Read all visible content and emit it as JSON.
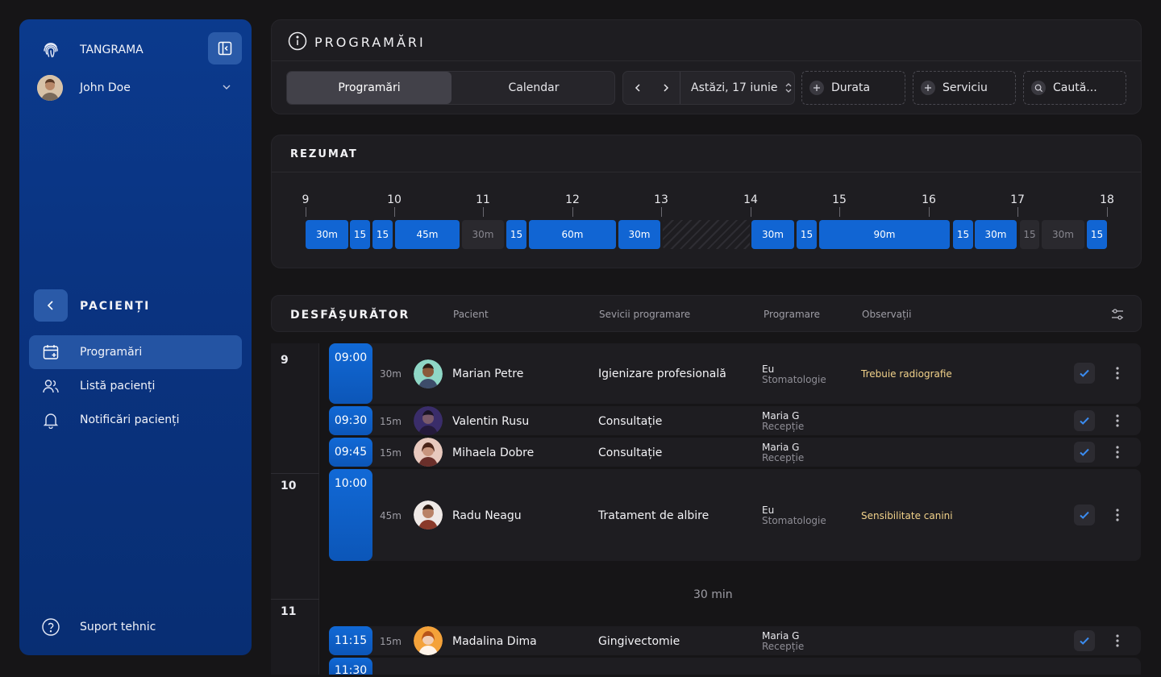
{
  "sidebar": {
    "brand": "TANGRAMA",
    "user": "John Doe",
    "section": "PACIENȚI",
    "items": [
      {
        "label": "Programări",
        "active": true
      },
      {
        "label": "Listă pacienți"
      },
      {
        "label": "Notificări pacienți"
      }
    ],
    "support": "Suport tehnic"
  },
  "header": {
    "title": "PROGRAMĂRI",
    "tabs": [
      "Programări",
      "Calendar"
    ],
    "date": "Astăzi, 17 iunie",
    "filters": [
      "Durata",
      "Serviciu"
    ],
    "search_placeholder": "Caută..."
  },
  "summary": {
    "title": "REZUMAT",
    "hours": [
      "9",
      "10",
      "11",
      "12",
      "13",
      "14",
      "15",
      "16",
      "17",
      "18"
    ],
    "blocks": [
      "30m",
      "15",
      "15",
      "45m",
      "30m",
      "15",
      "60m",
      "30m",
      "30m",
      "15",
      "90m",
      "15",
      "30m",
      "15",
      "30m",
      "15"
    ]
  },
  "schedule": {
    "title": "DESFĂȘURĂTOR",
    "columns": [
      "Pacient",
      "Sevicii programare",
      "Programare",
      "Observații"
    ],
    "hour_labels": [
      "9",
      "10",
      "11"
    ],
    "gap_label": "30 min",
    "rows": [
      {
        "time": "09:00",
        "dur": "30m",
        "patient": "Marian Petre",
        "service": "Igienizare profesională",
        "by": "Eu",
        "dept": "Stomatologie",
        "note": "Trebuie radiografie"
      },
      {
        "time": "09:30",
        "dur": "15m",
        "patient": "Valentin Rusu",
        "service": "Consultație",
        "by": "Maria G",
        "dept": "Recepție",
        "note": ""
      },
      {
        "time": "09:45",
        "dur": "15m",
        "patient": "Mihaela Dobre",
        "service": "Consultație",
        "by": "Maria G",
        "dept": "Recepție",
        "note": ""
      },
      {
        "time": "10:00",
        "dur": "45m",
        "patient": "Radu Neagu",
        "service": "Tratament de albire",
        "by": "Eu",
        "dept": "Stomatologie",
        "note": "Sensibilitate canini"
      },
      {
        "time": "11:15",
        "dur": "15m",
        "patient": "Madalina Dima",
        "service": "Gingivectomie",
        "by": "Maria G",
        "dept": "Recepție",
        "note": ""
      },
      {
        "time": "11:30"
      }
    ]
  },
  "colors": {
    "accent": "#1165d3",
    "sidebar": "#0a3380",
    "note": "#f2d28a",
    "panel": "#1e1d21"
  }
}
